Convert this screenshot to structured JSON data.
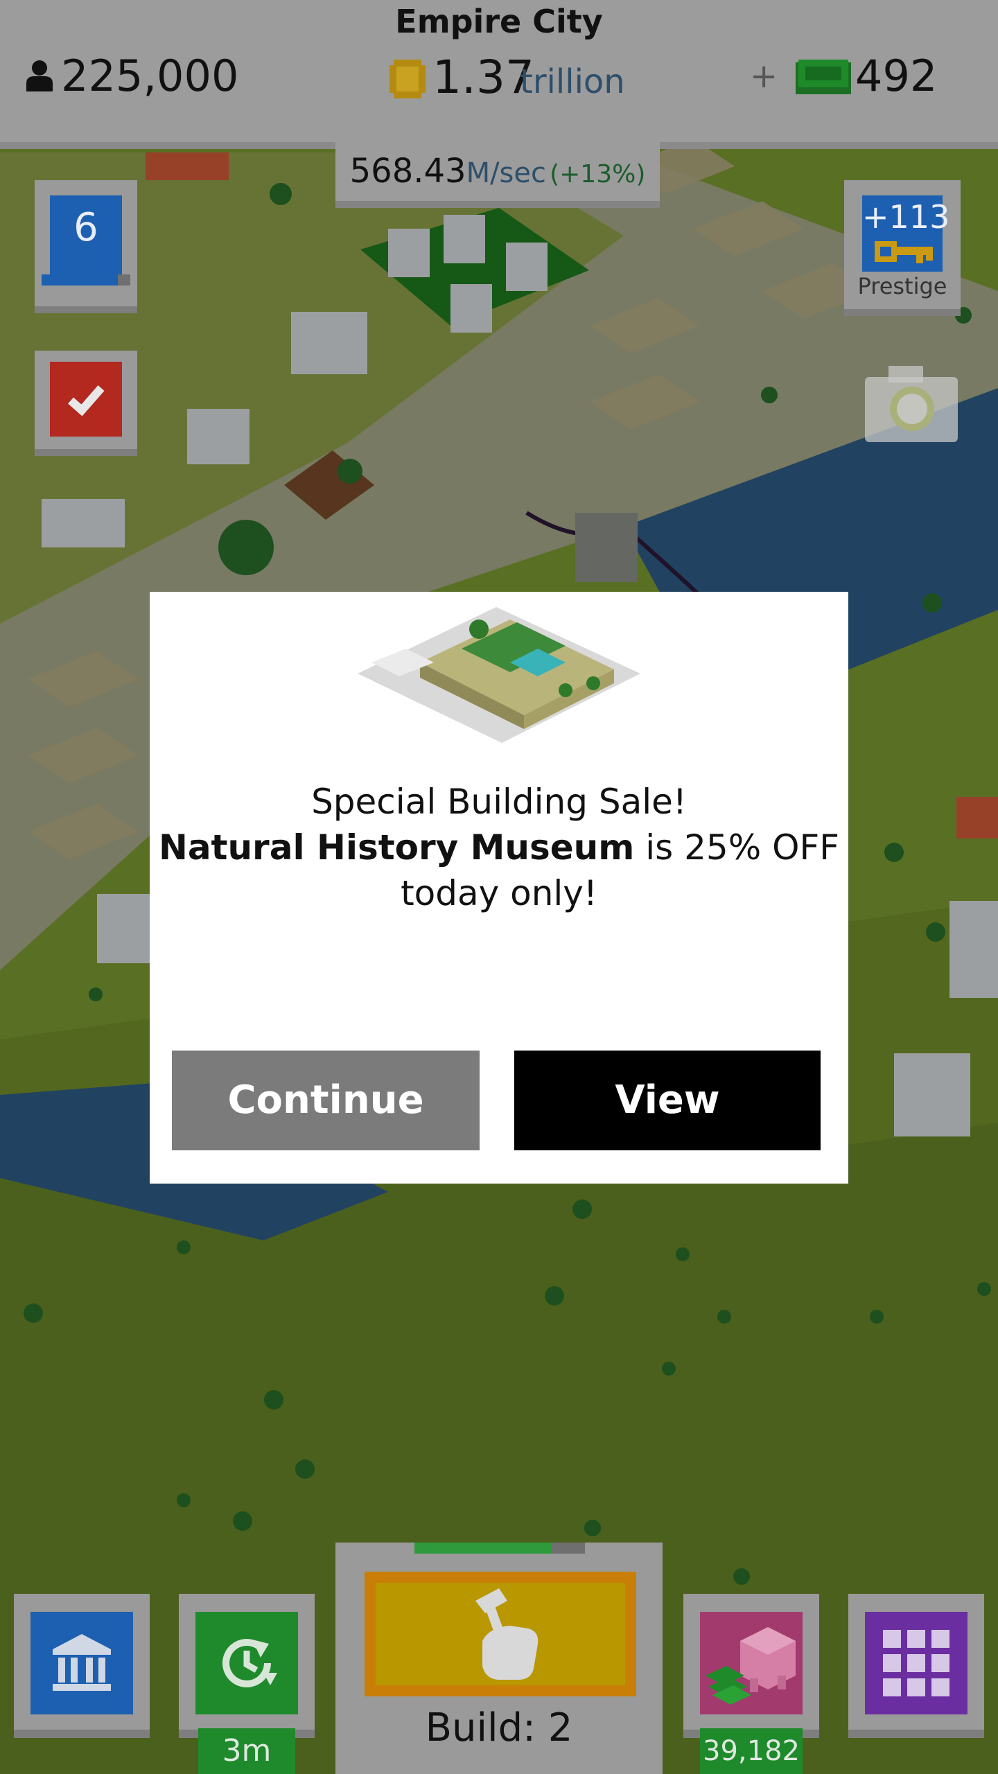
{
  "header": {
    "city_name": "Empire City",
    "population": "225,000",
    "money_value": "1.37",
    "money_unit": "trillion",
    "bills_value": "492"
  },
  "income": {
    "amount": "568.43",
    "unit": "M/sec",
    "boost": "(+13%)"
  },
  "level": {
    "number": "6",
    "progress_fraction": 0.86
  },
  "prestige": {
    "count": "+113",
    "label": "Prestige"
  },
  "dialog": {
    "title": "Special Building Sale!",
    "building_name": "Natural History Museum",
    "offer_text": " is 25% OFF",
    "offer_end": "today only!",
    "continue_label": "Continue",
    "view_label": "View"
  },
  "bottom_bar": {
    "boost_timer": "3m",
    "build_label": "Build: 2",
    "build_progress_fraction": 0.8,
    "piggy_bank_value": "39,182"
  },
  "colors": {
    "topbar": "#9c9c9c",
    "card_blue": "#1d5fb0",
    "card_green": "#1e8a2c",
    "card_red": "#b3281f",
    "card_purple": "#6a2ea0",
    "card_pink": "#a23a6e",
    "build_orange": "#c97f07",
    "view_button": "#000000",
    "continue_button": "#7b7b7b"
  },
  "icons": [
    "person-icon",
    "coin-icon",
    "plus-icon",
    "cash-icon",
    "checkmark-icon",
    "key-icon",
    "camera-icon",
    "bank-icon",
    "clock-arrow-icon",
    "hammer-hand-icon",
    "piggy-bank-icon",
    "grid-menu-icon",
    "museum-image"
  ]
}
